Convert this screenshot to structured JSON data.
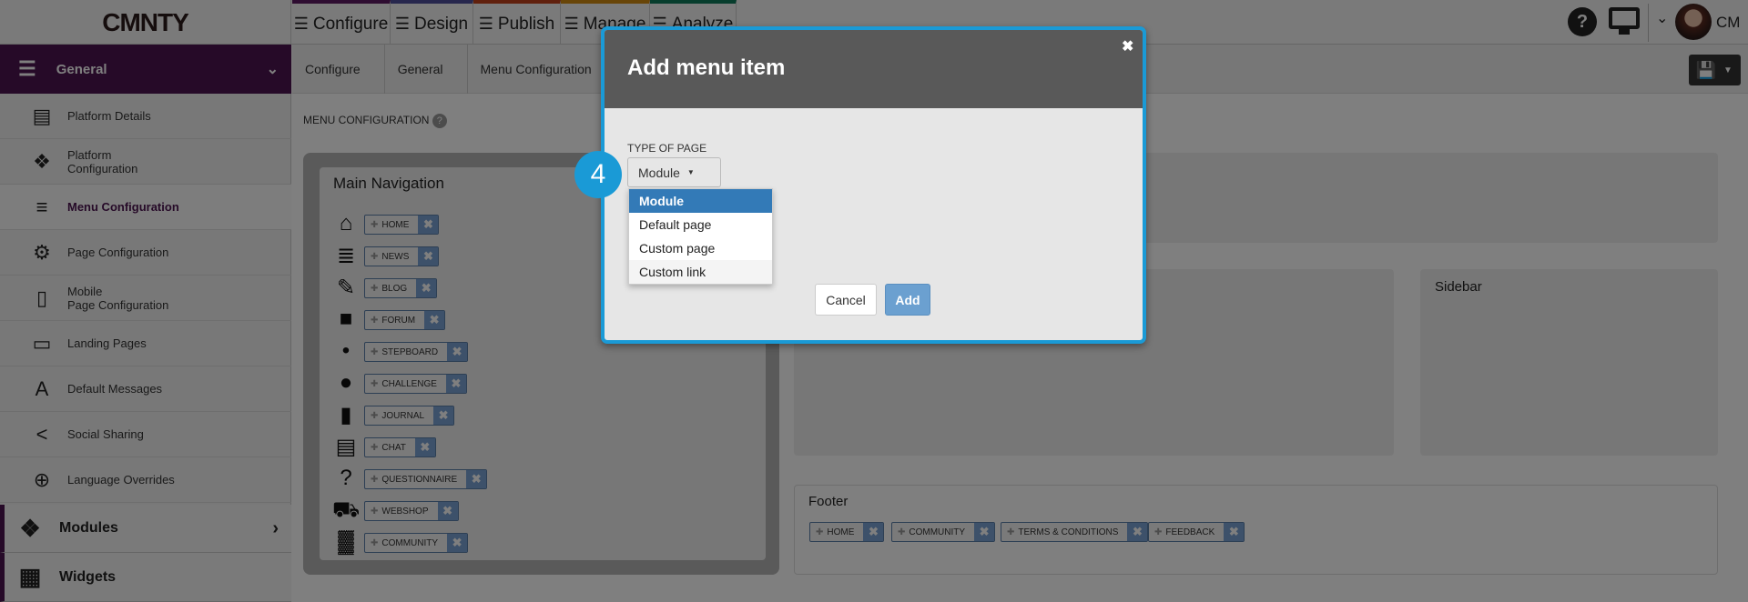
{
  "logo": "CMNTY",
  "nav": [
    {
      "label": "Configure",
      "color": "#5c1a63"
    },
    {
      "label": "Design",
      "color": "#4f4f9a"
    },
    {
      "label": "Publish",
      "color": "#c0401a"
    },
    {
      "label": "Manage",
      "color": "#d08a10"
    },
    {
      "label": "Analyze",
      "color": "#0f7a5a"
    }
  ],
  "header": {
    "user_initials": "CM"
  },
  "sidebar": {
    "section": "General",
    "items": [
      {
        "label": "Platform Details",
        "icon": "layout-icon"
      },
      {
        "label": "Platform\nConfiguration",
        "icon": "puzzle-icon"
      },
      {
        "label": "Menu Configuration",
        "icon": "menu-gear-icon",
        "active": true
      },
      {
        "label": "Page Configuration",
        "icon": "page-gear-icon"
      },
      {
        "label": "Mobile\nPage Configuration",
        "icon": "mobile-gear-icon"
      },
      {
        "label": "Landing Pages",
        "icon": "laptop-icon"
      },
      {
        "label": "Default Messages",
        "icon": "text-icon"
      },
      {
        "label": "Social Sharing",
        "icon": "share-icon"
      },
      {
        "label": "Language Overrides",
        "icon": "globe-edit-icon"
      }
    ],
    "modules": "Modules",
    "widgets": "Widgets"
  },
  "breadcrumb": [
    "Configure",
    "General",
    "Menu Configuration"
  ],
  "page": {
    "heading": "MENU CONFIGURATION",
    "help": "?"
  },
  "main_nav": {
    "title": "Main Navigation",
    "items": [
      {
        "label": "HOME",
        "icon": "home-icon"
      },
      {
        "label": "NEWS",
        "icon": "news-icon"
      },
      {
        "label": "BLOG",
        "icon": "blog-icon"
      },
      {
        "label": "FORUM",
        "icon": "forum-icon"
      },
      {
        "label": "STEPBOARD",
        "icon": "footsteps-icon"
      },
      {
        "label": "CHALLENGE",
        "icon": "lightbulb-icon"
      },
      {
        "label": "JOURNAL",
        "icon": "journal-icon"
      },
      {
        "label": "CHAT",
        "icon": "chat-icon"
      },
      {
        "label": "QUESTIONNAIRE",
        "icon": "question-icon"
      },
      {
        "label": "WEBSHOP",
        "icon": "cart-icon"
      },
      {
        "label": "COMMUNITY",
        "icon": "community-icon"
      }
    ]
  },
  "sidebar_region": {
    "title": "Sidebar"
  },
  "footer_region": {
    "title": "Footer",
    "items": [
      "HOME",
      "COMMUNITY",
      "TERMS & CONDITIONS",
      "FEEDBACK"
    ]
  },
  "modal": {
    "title": "Add menu item",
    "type_label": "TYPE OF PAGE",
    "selected": "Module",
    "options": [
      "Module",
      "Default page",
      "Custom page",
      "Custom link"
    ],
    "cancel": "Cancel",
    "add": "Add",
    "step": "4"
  }
}
